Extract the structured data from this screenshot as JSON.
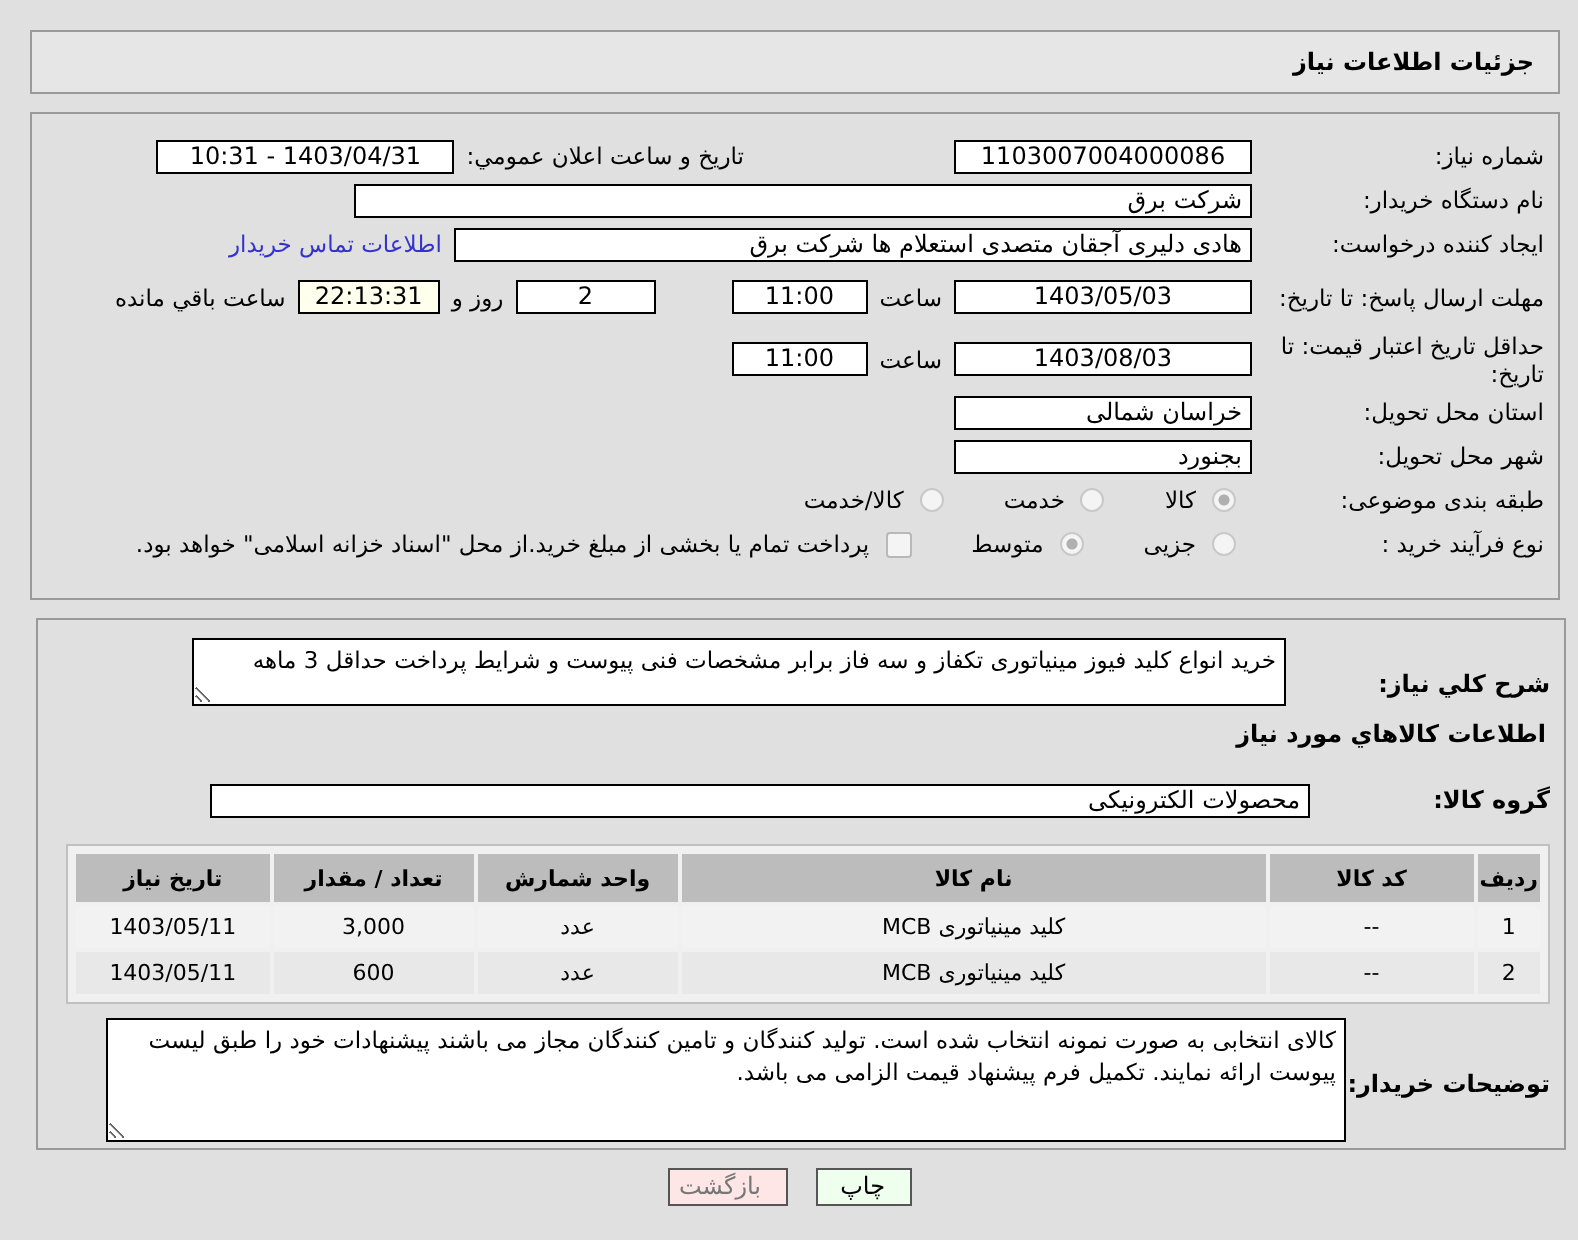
{
  "header": {
    "title": "جزئیات اطلاعات نیاز"
  },
  "need_number": {
    "label": "شماره نیاز:",
    "value": "1103007004000086"
  },
  "announce": {
    "label": "تاریخ و ساعت اعلان عمومي:",
    "value": "1403/04/31 - 10:31"
  },
  "buyer_org": {
    "label": "نام دستگاه خریدار:",
    "value": "شرکت برق"
  },
  "requester": {
    "label": "ایجاد کننده درخواست:",
    "value": "هادی دلیری آجقان متصدی استعلام ها  شرکت برق",
    "link": "اطلاعات تماس خریدار"
  },
  "reply_deadline": {
    "label": "مهلت ارسال پاسخ: تا تاریخ:",
    "date": "1403/05/03",
    "time_label": "ساعت",
    "time": "11:00",
    "days": "2",
    "days_label": "روز و",
    "remaining": "22:13:31",
    "remaining_label": "ساعت باقي مانده"
  },
  "price_validity": {
    "label": "حداقل تاریخ اعتبار قیمت: تا تاریخ:",
    "date": "1403/08/03",
    "time_label": "ساعت",
    "time": "11:00"
  },
  "province": {
    "label": "استان محل تحویل:",
    "value": "خراسان شمالی"
  },
  "city": {
    "label": "شهر محل تحویل:",
    "value": "بجنورد"
  },
  "category": {
    "label": "طبقه بندی موضوعی:",
    "options": [
      {
        "label": "کالا",
        "selected": true
      },
      {
        "label": "خدمت",
        "selected": false
      },
      {
        "label": "کالا/خدمت",
        "selected": false
      }
    ]
  },
  "process": {
    "label": "نوع فرآیند خرید :",
    "options": [
      {
        "label": "جزیی",
        "selected": false
      },
      {
        "label": "متوسط",
        "selected": true
      }
    ],
    "treasury": {
      "label": "پرداخت تمام یا بخشی از مبلغ خرید.از محل \"اسناد خزانه اسلامی\" خواهد بود.",
      "checked": false
    }
  },
  "description": {
    "label": "شرح کلي نیاز:",
    "value": "خرید انواع کلید فیوز مینیاتوری تکفاز و سه فاز برابر مشخصات فنی پیوست و شرایط پرداخت حداقل 3 ماهه"
  },
  "goods_title": "اطلاعات کالاهاي مورد نیاز",
  "goods_group": {
    "label": "گروه کالا:",
    "value": "محصولات الکترونیکی"
  },
  "table": {
    "columns": [
      "ردیف",
      "کد کالا",
      "نام کالا",
      "واحد شمارش",
      "تعداد / مقدار",
      "تاریخ نیاز"
    ],
    "rows": [
      [
        "1",
        "--",
        "کلید مینیاتوری MCB",
        "عدد",
        "3,000",
        "1403/05/11"
      ],
      [
        "2",
        "--",
        "کلید مینیاتوری MCB",
        "عدد",
        "600",
        "1403/05/11"
      ]
    ]
  },
  "buyer_notes": {
    "label": "توضیحات خریدار:",
    "value": "کالای انتخابی به صورت نمونه انتخاب شده است. تولید کنندگان و تامین کنندگان مجاز می باشند پیشنهادات خود را طبق لیست پیوست ارائه نمایند. تکمیل فرم پیشنهاد قیمت الزامی می باشد."
  },
  "buttons": [
    {
      "label": "چاپ",
      "kind": "print"
    },
    {
      "label": "بازگشت",
      "kind": "back"
    }
  ]
}
